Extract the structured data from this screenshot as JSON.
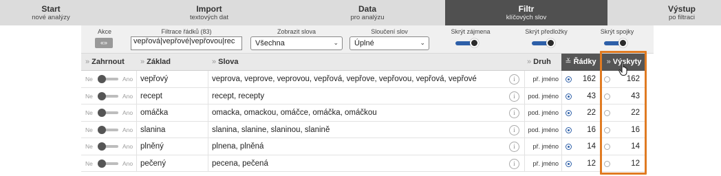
{
  "steps": [
    {
      "title": "Start",
      "subtitle": "nové analýzy",
      "active": false
    },
    {
      "title": "Import",
      "subtitle": "textových dat",
      "active": false
    },
    {
      "title": "Data",
      "subtitle": "pro analýzu",
      "active": false
    },
    {
      "title": "Filtr",
      "subtitle": "klíčových slov",
      "active": true
    },
    {
      "title": "Výstup",
      "subtitle": "po filtraci",
      "active": false
    }
  ],
  "controls": {
    "akce_label": "Akce",
    "akce_button": "«»",
    "filter_label": "Filtrace řádků (83)",
    "filter_value": "vepřová|vepřové|vepřovou|rec",
    "show_words_label": "Zobrazit slova",
    "show_words_value": "Všechna",
    "merge_label": "Sloučení slov",
    "merge_value": "Úplné",
    "hide_pronouns_label": "Skrýt zájmena",
    "hide_prepositions_label": "Skrýt předložky",
    "hide_conjunctions_label": "Skrýt spojky"
  },
  "table": {
    "headers": {
      "include": "Zahrnout",
      "base": "Základ",
      "words": "Slova",
      "type": "Druh",
      "rows": "Řádky",
      "occurrences": "Výskyty"
    },
    "header_arrow": "»",
    "sort_arrow": "»",
    "no_label": "Ne",
    "yes_label": "Ano",
    "info_symbol": "i",
    "rows": [
      {
        "base": "vepřový",
        "words": "veprova, veprove, veprovou, vepřová, vepřove, vepřovou, vepřová, vepřové",
        "type": "př. jméno",
        "rows": "162",
        "occurrences": "162"
      },
      {
        "base": "recept",
        "words": "recept, recepty",
        "type": "pod. jméno",
        "rows": "43",
        "occurrences": "43"
      },
      {
        "base": "omáčka",
        "words": "omacka, omackou, omáčce, omáčka, omáčkou",
        "type": "pod. jméno",
        "rows": "22",
        "occurrences": "22"
      },
      {
        "base": "slanina",
        "words": "slanina, slanine, slaninou, slanině",
        "type": "pod. jméno",
        "rows": "16",
        "occurrences": "16"
      },
      {
        "base": "plněný",
        "words": "plnena, plněná",
        "type": "př. jméno",
        "rows": "14",
        "occurrences": "14"
      },
      {
        "base": "pečený",
        "words": "pecena, pečená",
        "type": "př. jméno",
        "rows": "12",
        "occurrences": "12"
      }
    ]
  },
  "colors": {
    "accent": "#2d5fa8",
    "highlight": "#e07b22",
    "active_step": "#505050"
  }
}
